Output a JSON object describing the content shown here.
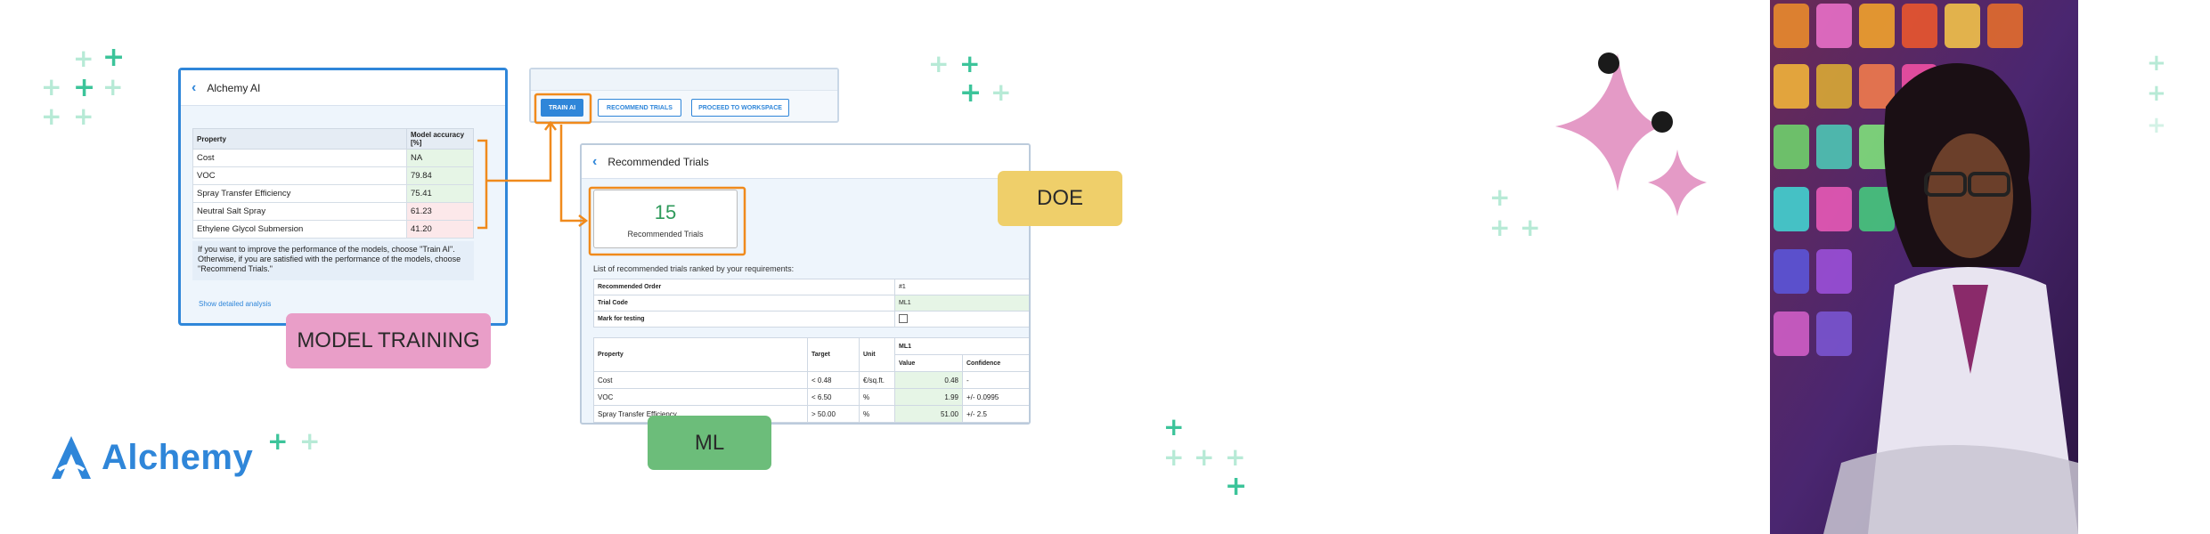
{
  "brand": {
    "name": "Alchemy",
    "color": "#2f86d9"
  },
  "panel1": {
    "title": "Alchemy AI",
    "table": {
      "headers": [
        "Property",
        "Model accuracy [%]"
      ],
      "rows": [
        {
          "property": "Cost",
          "accuracy": "NA",
          "status": "green"
        },
        {
          "property": "VOC",
          "accuracy": "79.84",
          "status": "green"
        },
        {
          "property": "Spray Transfer Efficiency",
          "accuracy": "75.41",
          "status": "green"
        },
        {
          "property": "Neutral Salt Spray",
          "accuracy": "61.23",
          "status": "red"
        },
        {
          "property": "Ethylene Glycol Submersion",
          "accuracy": "41.20",
          "status": "red"
        }
      ]
    },
    "note": "If you want to improve the performance of the models, choose \"Train AI\". Otherwise, if you are satisfied with the performance of the models, choose \"Recommend Trials.\"",
    "link": "Show detailed analysis"
  },
  "toolbar": {
    "train": "TRAIN AI",
    "recommend": "RECOMMEND TRIALS",
    "proceed": "PROCEED TO WORKSPACE"
  },
  "panel2": {
    "title": "Recommended Trials",
    "card": {
      "value": "15",
      "label": "Recommended Trials"
    },
    "list_label": "List of recommended trials ranked by your requirements:",
    "meta": [
      {
        "key": "Recommended Order",
        "value": "#1"
      },
      {
        "key": "Trial Code",
        "value": "ML1"
      },
      {
        "key": "Mark for testing",
        "value": ""
      }
    ],
    "table": {
      "headers": {
        "property": "Property",
        "target": "Target",
        "unit": "Unit",
        "trial": "ML1",
        "value": "Value",
        "confidence": "Confidence"
      },
      "rows": [
        {
          "property": "Cost",
          "target": "< 0.48",
          "unit": "€/sq.ft.",
          "value": "0.48",
          "confidence": "-"
        },
        {
          "property": "VOC",
          "target": "< 6.50",
          "unit": "%",
          "value": "1.99",
          "confidence": "+/- 0.0995"
        },
        {
          "property": "Spray Transfer Efficiency",
          "target": "> 50.00",
          "unit": "%",
          "value": "51.00",
          "confidence": "+/- 2.5"
        }
      ]
    }
  },
  "labels": {
    "model": "MODEL TRAINING",
    "doe": "DOE",
    "ml": "ML"
  },
  "colors": {
    "accent": "#2f86d9",
    "highlight": "#f08a1c",
    "model_tag": "#e99ec8",
    "doe_tag": "#efcf6a",
    "ml_tag": "#6cbd7a",
    "plus_dark": "#3cc49a",
    "plus_light": "#b7ead6",
    "sparkle": "#e49ac6"
  },
  "icons": {
    "back": "chevron-left-icon",
    "sparkle": "sparkle-star-icon",
    "logo": "alchemy-a-logo-icon",
    "plus": "plus-icon"
  }
}
